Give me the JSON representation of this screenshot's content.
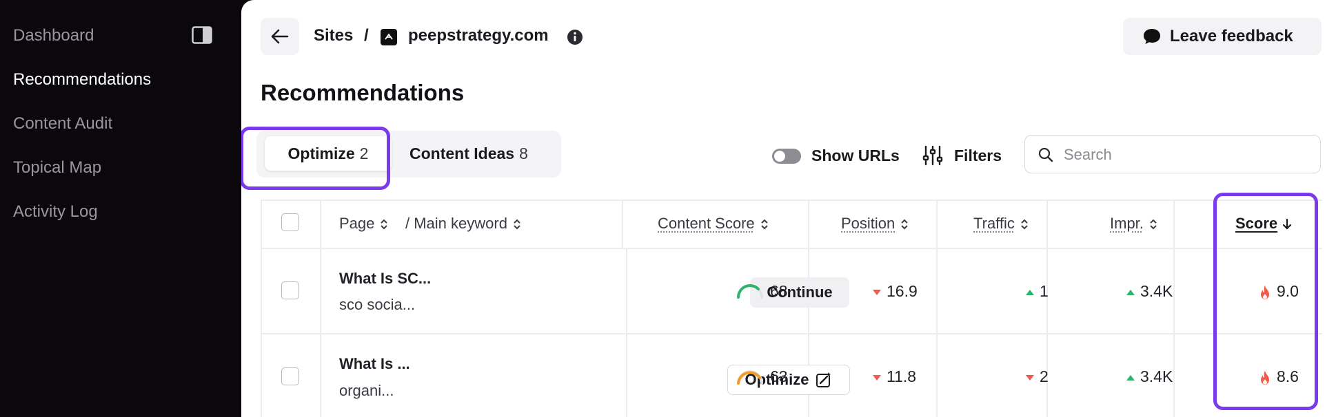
{
  "sidebar": {
    "items": [
      {
        "label": "Dashboard",
        "active": false
      },
      {
        "label": "Recommendations",
        "active": true
      },
      {
        "label": "Content Audit",
        "active": false
      },
      {
        "label": "Topical Map",
        "active": false
      },
      {
        "label": "Activity Log",
        "active": false
      }
    ],
    "toggle_icon": "sidebar-panel-icon"
  },
  "header": {
    "breadcrumb_root": "Sites",
    "breadcrumb_separator": "/",
    "site_name": "peepstrategy.com",
    "feedback_label": "Leave feedback"
  },
  "page": {
    "title": "Recommendations"
  },
  "tabs": [
    {
      "label": "Optimize",
      "count": "2",
      "selected": true
    },
    {
      "label": "Content Ideas",
      "count": "8",
      "selected": false
    }
  ],
  "toolbar": {
    "show_urls_label": "Show URLs",
    "show_urls_on": false,
    "filters_label": "Filters",
    "search_placeholder": "Search"
  },
  "table": {
    "columns": {
      "page": "Page",
      "keyword": "/ Main keyword",
      "content_score": "Content Score",
      "position": "Position",
      "traffic": "Traffic",
      "impressions": "Impr.",
      "score": "Score"
    },
    "sorted_by": "Score",
    "rows": [
      {
        "title": "What Is SC...",
        "keyword": "sco socia...",
        "action": "Continue",
        "content_score": "68",
        "content_score_color": "#2fb36a",
        "position": "16.9",
        "position_trend": "down",
        "traffic": "1",
        "traffic_trend": "up",
        "impressions": "3.4K",
        "impressions_trend": "up",
        "score": "9.0"
      },
      {
        "title": "What Is ...",
        "keyword": "organi...",
        "action": "Optimize",
        "content_score": "63",
        "content_score_color": "#f59a23",
        "position": "11.8",
        "position_trend": "down",
        "traffic": "2",
        "traffic_trend": "down",
        "impressions": "3.4K",
        "impressions_trend": "up",
        "score": "8.6"
      }
    ]
  },
  "colors": {
    "highlight": "#7c3aed",
    "up": "#2fb36a",
    "down": "#f25a4a",
    "flame": "#f25a4a"
  }
}
